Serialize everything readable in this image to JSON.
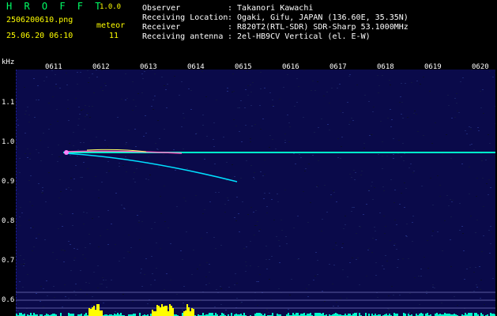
{
  "header": {
    "app_name": "H R O F F T",
    "version": "1.0.0",
    "filename": "2506200610.png",
    "meteor_label": "meteor",
    "datetime": "25.06.20 06:10",
    "meteor_count": "11",
    "info": [
      {
        "key": "Observer",
        "value": ": Takanori Kawachi"
      },
      {
        "key": "Receiving Location",
        "value": ": Ogaki, Gifu, JAPAN (136.60E, 35.35N)"
      },
      {
        "key": "Receiver",
        "value": ": R820T2(RTL-SDR) SDR-Sharp 53.1000MHz"
      },
      {
        "key": "Receiving antenna",
        "value": ": 2el-HB9CV Vertical (el. E-W)"
      }
    ]
  },
  "axes": {
    "y_unit": "kHz",
    "y_ticks": [
      "1.1",
      "1.0",
      "0.9",
      "0.8",
      "0.7",
      "0.6"
    ],
    "x_ticks": [
      "0611",
      "0612",
      "0613",
      "0614",
      "0615",
      "0616",
      "0617",
      "0618",
      "0619",
      "0620"
    ]
  },
  "colors": {
    "background": "#000000",
    "noise": "#0a0a4a",
    "signal": "#00ffcc",
    "meteor": "#00e0ff",
    "grid": "#1e1e90",
    "bars": "#ffff00"
  }
}
